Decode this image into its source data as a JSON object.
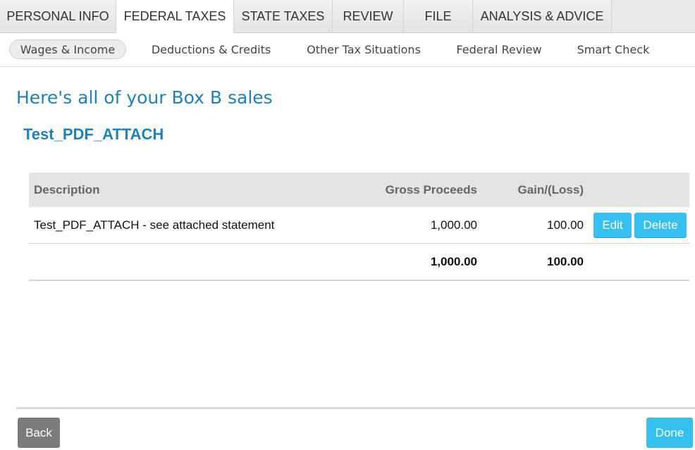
{
  "top_tabs": [
    {
      "label": "PERSONAL INFO"
    },
    {
      "label": "FEDERAL TAXES",
      "active": true
    },
    {
      "label": "STATE TAXES"
    },
    {
      "label": "REVIEW"
    },
    {
      "label": "FILE"
    },
    {
      "label": "ANALYSIS & ADVICE"
    }
  ],
  "sub_tabs": [
    {
      "label": "Wages & Income",
      "active": true
    },
    {
      "label": "Deductions & Credits"
    },
    {
      "label": "Other Tax Situations"
    },
    {
      "label": "Federal Review"
    },
    {
      "label": "Smart Check"
    }
  ],
  "page": {
    "title": "Here's all of your Box B sales",
    "subtitle": "Test_PDF_ATTACH"
  },
  "table": {
    "headers": {
      "description": "Description",
      "gross_proceeds": "Gross Proceeds",
      "gain_loss": "Gain/(Loss)"
    },
    "rows": [
      {
        "description": "Test_PDF_ATTACH - see attached statement",
        "gross_proceeds": "1,000.00",
        "gain_loss": "100.00",
        "edit_label": "Edit",
        "delete_label": "Delete"
      }
    ],
    "totals": {
      "gross_proceeds": "1,000.00",
      "gain_loss": "100.00"
    }
  },
  "footer": {
    "back_label": "Back",
    "done_label": "Done"
  },
  "colors": {
    "accent_blue": "#1b82bf",
    "button_blue": "#36c0f0",
    "back_gray": "#7b7b7b"
  }
}
